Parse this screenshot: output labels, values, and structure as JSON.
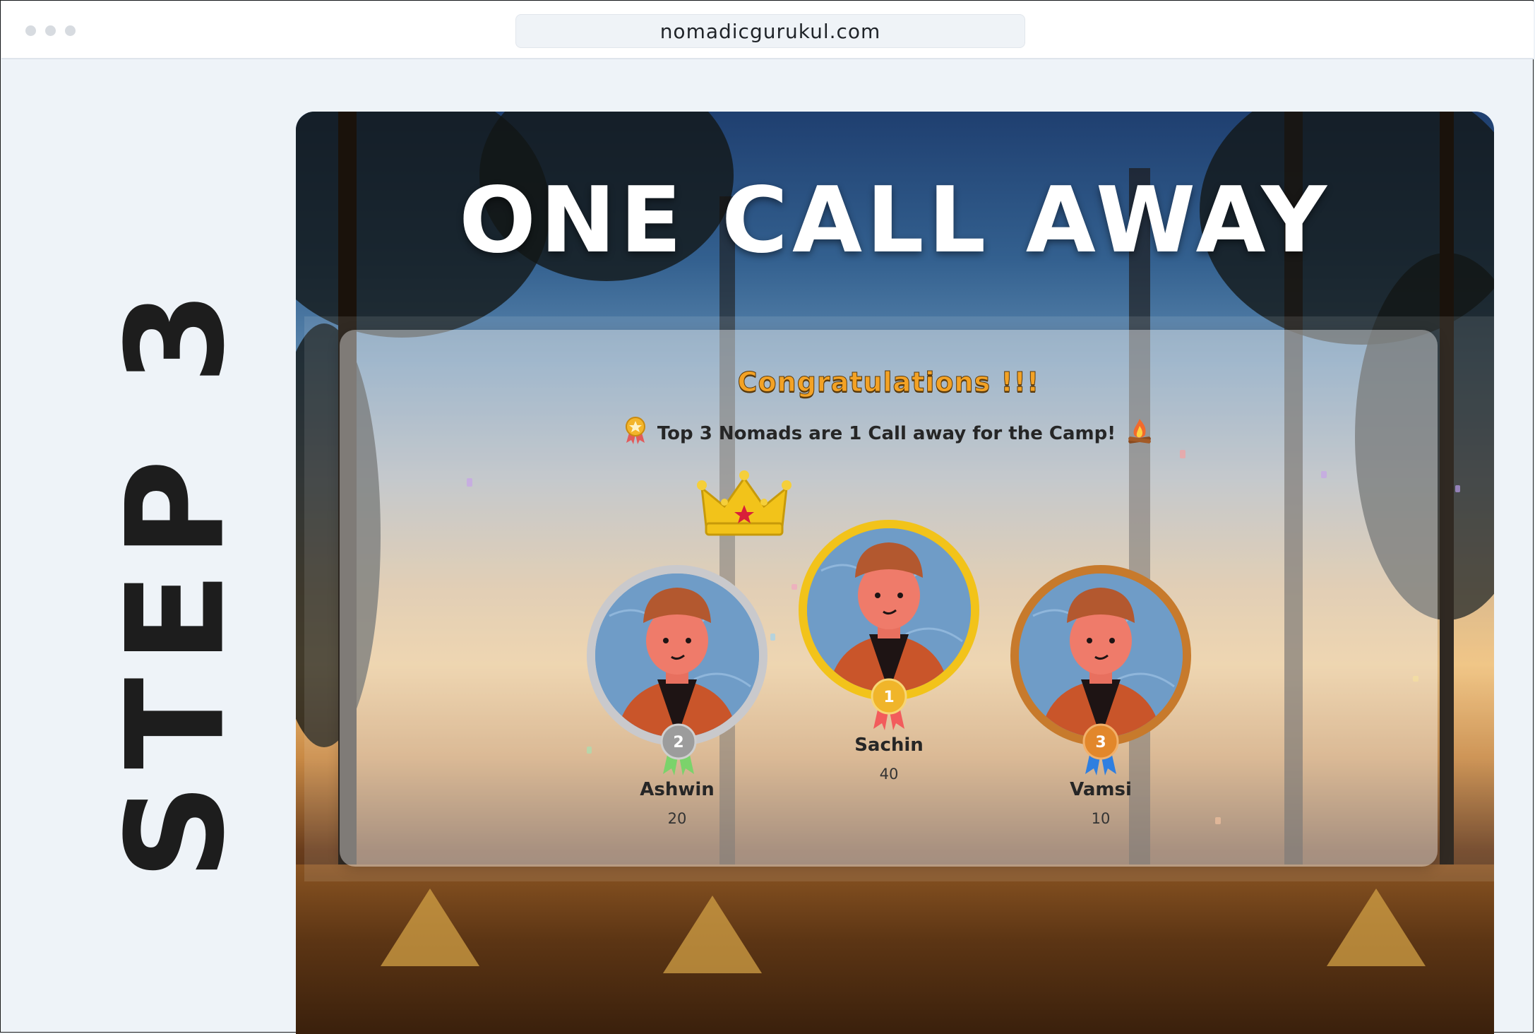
{
  "browser": {
    "url": "nomadicgurukul.com"
  },
  "side_label": "STEP 3",
  "hero": {
    "title": "ONE CALL AWAY"
  },
  "card": {
    "heading": "Congratulations !!!",
    "subtitle": "Top 3 Nomads are 1 Call away for the Camp!",
    "subtitle_leading_icon": "medal-icon",
    "subtitle_trailing_icon": "campfire-icon"
  },
  "leaderboard": [
    {
      "rank": "2",
      "name": "Ashwin",
      "score": "20",
      "ring_color": "#c9c9cc",
      "medal_color": "#9c9c9c",
      "ribbon_color": "#7bd36b"
    },
    {
      "rank": "1",
      "name": "Sachin",
      "score": "40",
      "ring_color": "#f2c31a",
      "medal_color": "#f0b52a",
      "ribbon_color": "#f25c5c"
    },
    {
      "rank": "3",
      "name": "Vamsi",
      "score": "10",
      "ring_color": "#c77a2c",
      "medal_color": "#e2872b",
      "ribbon_color": "#2f7fe0"
    }
  ],
  "colors": {
    "accent_gold": "#f3a225",
    "page_bg": "#eef3f8"
  }
}
